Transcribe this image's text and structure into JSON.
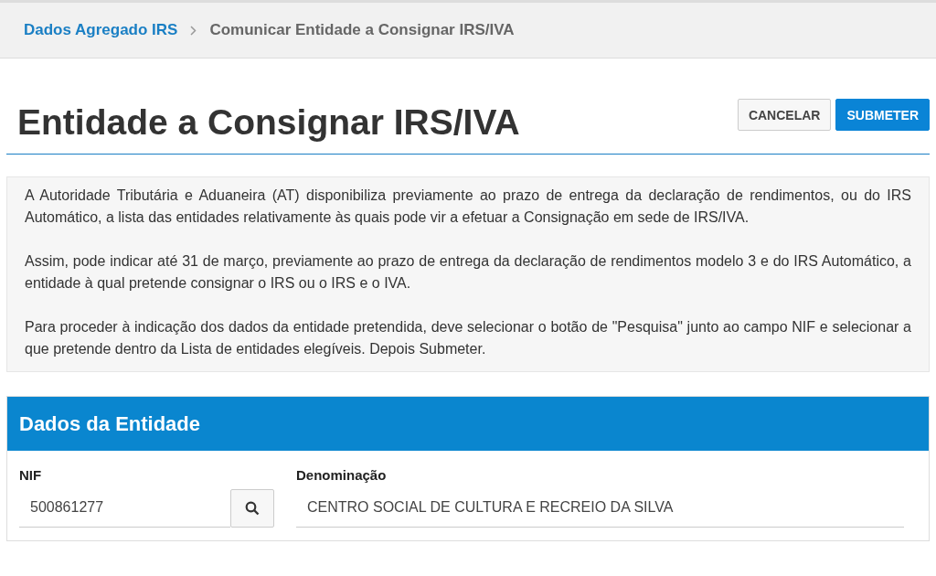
{
  "breadcrumb": [
    {
      "label": "Dados Agregado IRS",
      "kind": "link"
    },
    {
      "label": "Comunicar Entidade a Consignar IRS/IVA",
      "kind": "current"
    }
  ],
  "page_title": "Entidade a Consignar IRS/IVA",
  "buttons": [
    {
      "label": "CANCELAR",
      "kind": "secondary"
    },
    {
      "label": "SUBMETER",
      "kind": "primary"
    }
  ],
  "info_paragraphs": [
    "A Autoridade Tributária e Aduaneira (AT) disponibiliza previamente ao prazo de entrega da declaração de rendimentos, ou do IRS Automático, a lista das entidades relativamente às quais pode vir a efetuar a Consignação em sede de IRS/IVA.",
    "Assim, pode indicar até 31 de março, previamente ao prazo de entrega da declaração de rendimentos modelo 3 e do IRS Automático, a entidade à qual pretende consignar o IRS ou o IRS e o IVA.",
    "Para proceder à indicação dos dados da entidade pretendida, deve selecionar o botão de \"Pesquisa\" junto ao campo NIF e selecionar a que pretende dentro da Lista de entidades elegíveis. Depois Submeter."
  ],
  "panel": {
    "title": "Dados da Entidade",
    "fields": [
      {
        "label": "NIF",
        "value": "500861277",
        "kind": "search"
      },
      {
        "label": "Denominação",
        "value": "CENTRO SOCIAL DE CULTURA E RECREIO DA SILVA",
        "kind": "text"
      }
    ]
  }
}
